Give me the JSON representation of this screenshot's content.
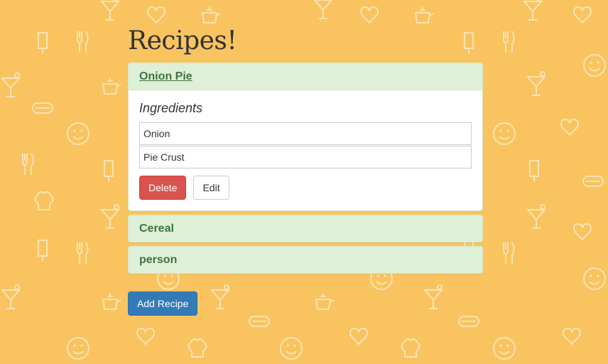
{
  "page": {
    "title": "Recipes!",
    "background_color": "#f9c460"
  },
  "recipes": [
    {
      "name": "Onion Pie",
      "expanded": true,
      "ingredients_heading": "Ingredients",
      "ingredients": [
        "Onion",
        "Pie Crust"
      ],
      "delete_label": "Delete",
      "edit_label": "Edit"
    },
    {
      "name": "Cereal",
      "expanded": false
    },
    {
      "name": "person",
      "expanded": false
    }
  ],
  "add_recipe_label": "Add Recipe",
  "colors": {
    "panel_heading_bg": "#dff0d8",
    "panel_heading_text": "#3c763d",
    "danger": "#d9534f",
    "primary": "#337ab7"
  }
}
